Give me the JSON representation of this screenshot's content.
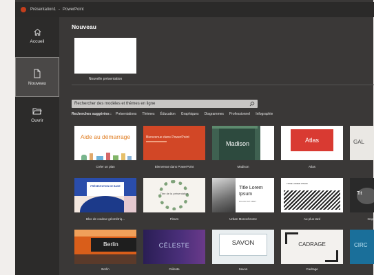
{
  "titlebar": {
    "document": "Présentation1",
    "app": "PowerPoint"
  },
  "nav": {
    "home": "Accueil",
    "new": "Nouveau",
    "open": "Ouvrir"
  },
  "main": {
    "heading": "Nouveau",
    "blank_label": "Nouvelle présentation",
    "search_placeholder": "Rechercher des modèles et thèmes en ligne",
    "suggest_label": "Recherches suggérées :",
    "suggestions": [
      "Présentations",
      "Thèmes",
      "Éducation",
      "Graphiques",
      "Diagrammes",
      "Professionnel",
      "Infographie"
    ]
  },
  "templates": [
    {
      "label": "Créer un plan",
      "title": "Aide au démarrage"
    },
    {
      "label": "Bienvenue dans PowerPoint",
      "title": "Bienvenue dans PowerPoint"
    },
    {
      "label": "Madison",
      "title": "Madison"
    },
    {
      "label": "Atlas",
      "title": "Atlas"
    },
    {
      "label": "",
      "title": "GAL"
    },
    {
      "label": "Bloc de couleur géométriq...",
      "title": "PRÉSENTATION DE BASE"
    },
    {
      "label": "Fleurs",
      "title": "Titre de la présentation"
    },
    {
      "label": "Urban Monochrome",
      "title": "Title Lorem Ipsum",
      "subtitle": "DOLOR SIT AMET"
    },
    {
      "label": "Au plus tard",
      "title": "TITRE LOREM IPSUM"
    },
    {
      "label": "Inspi",
      "title": "Tit"
    },
    {
      "label": "Berlin",
      "title": "Berlin"
    },
    {
      "label": "Céleste",
      "title": "CÉLESTE"
    },
    {
      "label": "Savon",
      "title": "SAVON"
    },
    {
      "label": "Cadrage",
      "title": "CADRAGE"
    },
    {
      "label": "",
      "title": "CIRC"
    }
  ]
}
